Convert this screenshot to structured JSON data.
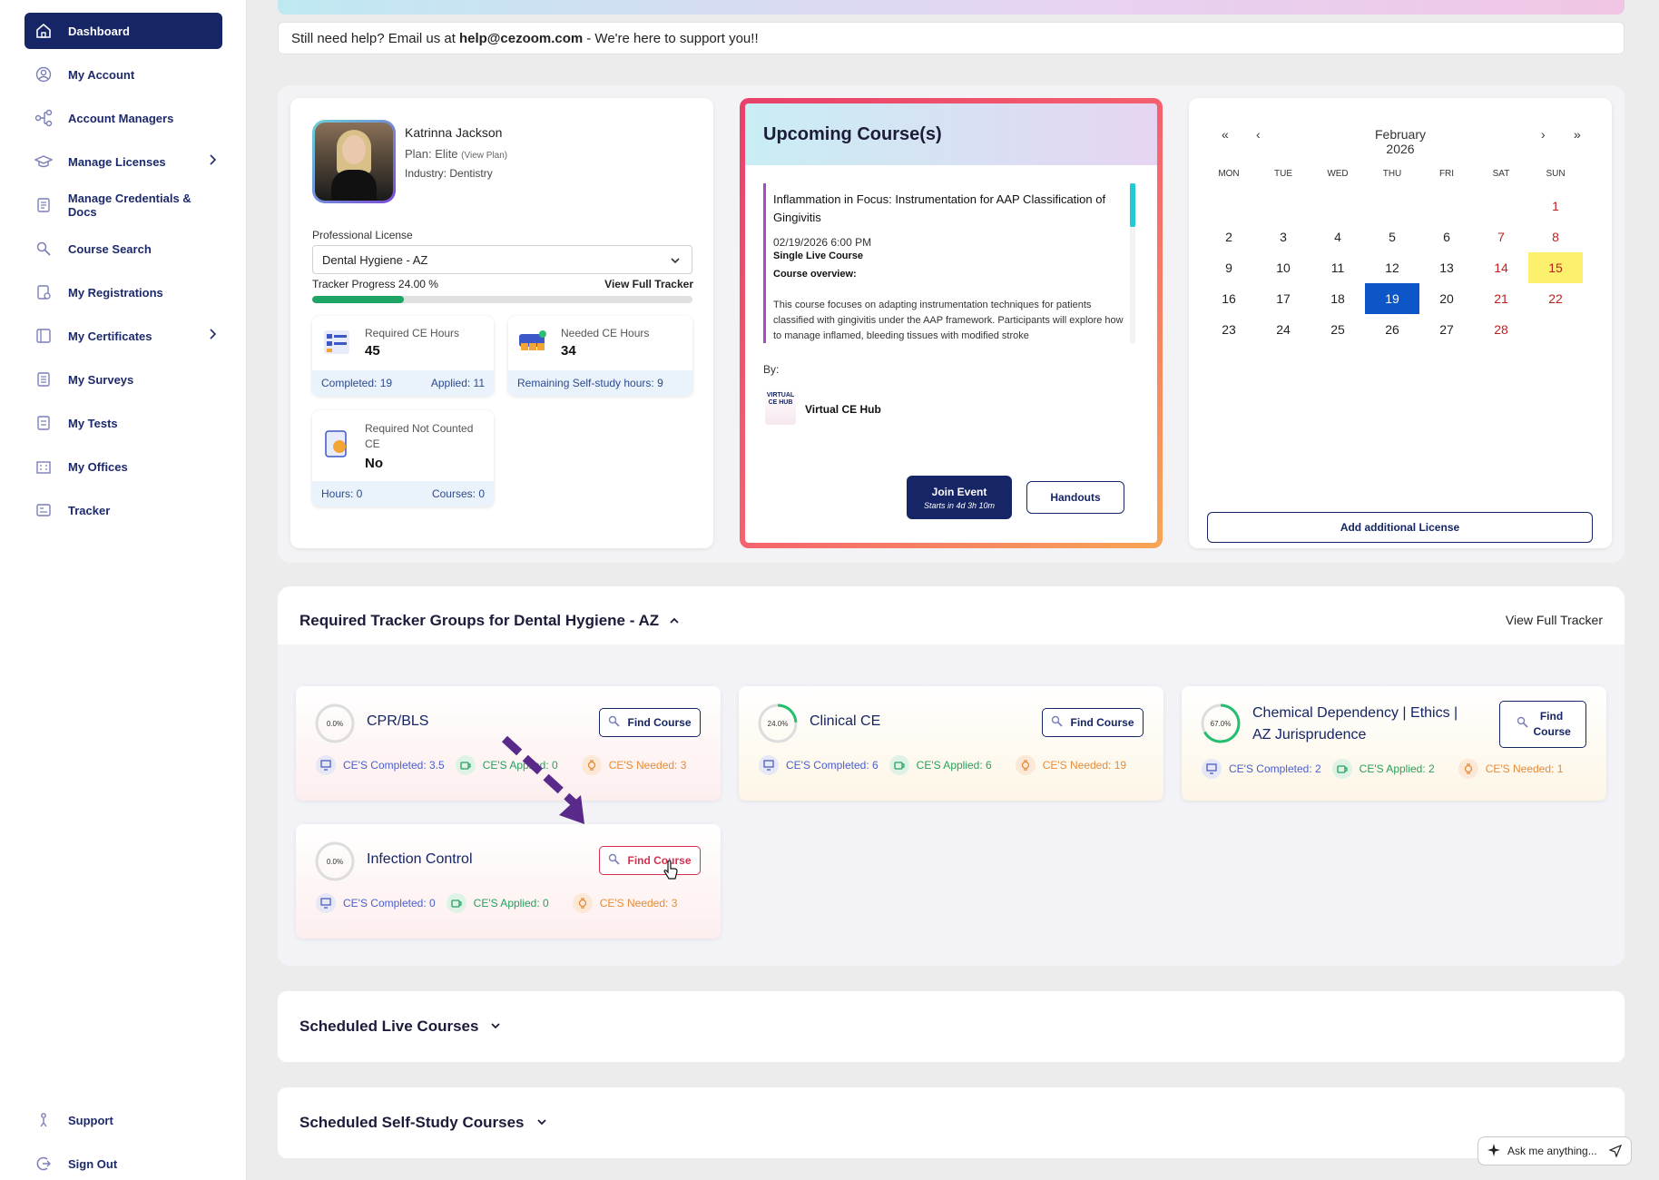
{
  "sidebar": {
    "items": [
      {
        "label": "Dashboard",
        "icon": "home-icon",
        "active": true
      },
      {
        "label": "My Account",
        "icon": "user-icon"
      },
      {
        "label": "Account Managers",
        "icon": "network-icon"
      },
      {
        "label": "Manage Licenses",
        "icon": "graduation-cap-icon",
        "expandable": true
      },
      {
        "label": "Manage Credentials & Docs",
        "icon": "document-icon"
      },
      {
        "label": "Course Search",
        "icon": "search-icon"
      },
      {
        "label": "My Registrations",
        "icon": "registration-icon"
      },
      {
        "label": "My Certificates",
        "icon": "certificate-icon",
        "expandable": true
      },
      {
        "label": "My Surveys",
        "icon": "survey-icon"
      },
      {
        "label": "My Tests",
        "icon": "test-icon"
      },
      {
        "label": "My Offices",
        "icon": "office-icon"
      },
      {
        "label": "Tracker",
        "icon": "tracker-icon"
      }
    ],
    "support_label": "Support",
    "signout_label": "Sign Out"
  },
  "help": {
    "prefix": "Still need help? Email us at",
    "email": "help@cezoom.com",
    "suffix": "- We're here to support you!!"
  },
  "profile": {
    "name": "Katrinna Jackson",
    "plan": "Plan: Elite",
    "view_plan": "(View Plan)",
    "industry": "Industry: Dentistry",
    "license_label": "Professional License",
    "license_value": "Dental Hygiene - AZ",
    "tracker_progress_label": "Tracker Progress 24.00 %",
    "tracker_progress": 0.24,
    "view_full_tracker": "View Full Tracker",
    "required": {
      "title": "Required CE Hours",
      "value": "45",
      "completed": "Completed: 19",
      "applied": "Applied: 11"
    },
    "needed": {
      "title": "Needed CE Hours",
      "value": "34",
      "remaining": "Remaining Self-study hours: 9"
    },
    "not_counted": {
      "title": "Required Not Counted CE",
      "value": "No",
      "hours": "Hours: 0",
      "courses": "Courses: 0"
    }
  },
  "upcoming": {
    "title": "Upcoming Course(s)",
    "course_title": "Inflammation in Focus: Instrumentation for AAP Classification of Gingivitis",
    "datetime": "02/19/2026 6:00 PM",
    "type": "Single Live Course",
    "overview_label": "Course overview:",
    "overview": "This course focuses on adapting instrumentation techniques for patients classified with gingivitis under the AAP framework. Participants will explore how to manage inflamed, bleeding tissues with modified stroke",
    "by_label": "By:",
    "provider": "Virtual CE Hub",
    "provider_logo_text": "VIRTUAL CE HUB",
    "join_label": "Join Event",
    "join_sub": "Starts in 4d 3h 10m",
    "handouts_label": "Handouts"
  },
  "calendar": {
    "month": "February 2026",
    "nav": {
      "first": "«",
      "prev": "‹",
      "next": "›",
      "last": "»"
    },
    "weekdays": [
      "MON",
      "TUE",
      "WED",
      "THU",
      "FRI",
      "SAT",
      "SUN"
    ],
    "first_weekday_index": 6,
    "days_in_month": 28,
    "today": 15,
    "selected": 19,
    "add_license_label": "Add additional License"
  },
  "tracker": {
    "title": "Required Tracker Groups for Dental Hygiene - AZ",
    "view_full": "View Full Tracker",
    "find_label": "Find Course",
    "groups": [
      {
        "name": "CPR/BLS",
        "pct": "0.0%",
        "progress": 0.0,
        "completed": "CE'S Completed: 3.5",
        "applied": "CE'S Applied: 0",
        "needed": "CE'S Needed: 3"
      },
      {
        "name": "Clinical CE",
        "pct": "24.0%",
        "progress": 0.24,
        "completed": "CE'S Completed: 6",
        "applied": "CE'S Applied: 6",
        "needed": "CE'S Needed: 19"
      },
      {
        "name": "Chemical Dependency | Ethics | AZ Jurisprudence",
        "pct": "67.0%",
        "progress": 0.67,
        "completed": "CE'S Completed: 2",
        "applied": "CE'S Applied: 2",
        "needed": "CE'S Needed: 1"
      },
      {
        "name": "Infection Control",
        "pct": "0.0%",
        "progress": 0.0,
        "completed": "CE'S Completed: 0",
        "applied": "CE'S Applied: 0",
        "needed": "CE'S Needed: 3"
      }
    ]
  },
  "sections": {
    "live": "Scheduled Live Courses",
    "self_study": "Scheduled Self-Study Courses"
  },
  "assistant": {
    "placeholder": "Ask me anything..."
  },
  "colors": {
    "navy": "#152565",
    "green": "#1ea463",
    "red": "#c01f1f",
    "today": "#fbf16c",
    "selected": "#0d56c7",
    "highlight": "#d6304f",
    "arrow": "#5a2a8a"
  }
}
